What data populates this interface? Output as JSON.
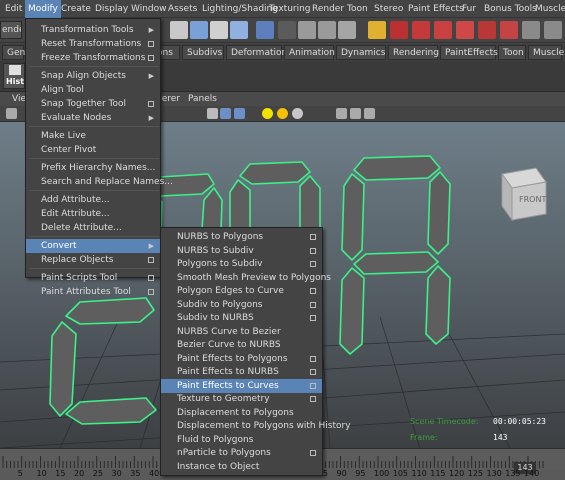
{
  "menubar": {
    "items": [
      {
        "label": "Edit"
      },
      {
        "label": "Modify"
      },
      {
        "label": "Create"
      },
      {
        "label": "Display"
      },
      {
        "label": "Window"
      },
      {
        "label": "Assets"
      },
      {
        "label": "Lighting/Shading"
      },
      {
        "label": "Texturing"
      },
      {
        "label": "Render"
      },
      {
        "label": "Toon"
      },
      {
        "label": "Stereo"
      },
      {
        "label": "Paint Effects"
      },
      {
        "label": "Fur"
      },
      {
        "label": "Bonus Tools"
      },
      {
        "label": "Muscle"
      }
    ],
    "active": "Modify"
  },
  "toolbar": {
    "mode_partial": "endering"
  },
  "shelf_tabs": [
    {
      "label": "Gen"
    },
    {
      "label": "ons"
    },
    {
      "label": "Subdivs"
    },
    {
      "label": "Deformation"
    },
    {
      "label": "Animation"
    },
    {
      "label": "Dynamics"
    },
    {
      "label": "Rendering"
    },
    {
      "label": "PaintEffects"
    },
    {
      "label": "Toon"
    },
    {
      "label": "Muscle"
    }
  ],
  "shelf": {
    "hist_label": "Hist"
  },
  "viewport": {
    "menu": [
      {
        "label": "Vie"
      },
      {
        "label": "derer"
      },
      {
        "label": "Panels"
      }
    ],
    "viewcube_label": "FRONT",
    "hud": {
      "time_label": "Scene Timecode:",
      "time_value": "00:00:05:23",
      "frame_label": "Frame:",
      "frame_value": "143"
    }
  },
  "modify_menu": {
    "items": [
      {
        "label": "Transformation Tools",
        "suffix": "arrow"
      },
      {
        "label": "Reset Transformations",
        "suffix": "box"
      },
      {
        "label": "Freeze Transformations",
        "suffix": "box"
      },
      {
        "label": "Snap Align Objects",
        "suffix": "arrow"
      },
      {
        "label": "Align Tool",
        "suffix": ""
      },
      {
        "label": "Snap Together Tool",
        "suffix": "box"
      },
      {
        "label": "Evaluate Nodes",
        "suffix": "arrow"
      },
      {
        "label": "Make Live",
        "suffix": ""
      },
      {
        "label": "Center Pivot",
        "suffix": ""
      },
      {
        "label": "Prefix Hierarchy Names...",
        "suffix": ""
      },
      {
        "label": "Search and Replace Names...",
        "suffix": ""
      },
      {
        "label": "Add Attribute...",
        "suffix": ""
      },
      {
        "label": "Edit Attribute...",
        "suffix": ""
      },
      {
        "label": "Delete Attribute...",
        "suffix": ""
      },
      {
        "label": "Convert",
        "suffix": "arrow"
      },
      {
        "label": "Replace Objects",
        "suffix": "box"
      },
      {
        "label": "Paint Scripts Tool",
        "suffix": "box"
      },
      {
        "label": "Paint Attributes Tool",
        "suffix": "box"
      }
    ],
    "active": "Convert"
  },
  "convert_menu": {
    "items": [
      {
        "label": "NURBS to Polygons",
        "suffix": "box"
      },
      {
        "label": "NURBS to Subdiv",
        "suffix": "box"
      },
      {
        "label": "Polygons to Subdiv",
        "suffix": "box"
      },
      {
        "label": "Smooth Mesh Preview to Polygons",
        "suffix": ""
      },
      {
        "label": "Polygon Edges to Curve",
        "suffix": "box"
      },
      {
        "label": "Subdiv to Polygons",
        "suffix": "box"
      },
      {
        "label": "Subdiv to NURBS",
        "suffix": "box"
      },
      {
        "label": "NURBS Curve to Bezier",
        "suffix": ""
      },
      {
        "label": "Bezier Curve to NURBS",
        "suffix": ""
      },
      {
        "label": "Paint Effects to Polygons",
        "suffix": "box"
      },
      {
        "label": "Paint Effects to NURBS",
        "suffix": "box"
      },
      {
        "label": "Paint Effects to Curves",
        "suffix": "box"
      },
      {
        "label": "Texture to Geometry",
        "suffix": "box"
      },
      {
        "label": "Displacement to Polygons",
        "suffix": ""
      },
      {
        "label": "Displacement to Polygons with History",
        "suffix": ""
      },
      {
        "label": "Fluid to Polygons",
        "suffix": ""
      },
      {
        "label": "nParticle to Polygons",
        "suffix": "box"
      },
      {
        "label": "Instance to Object",
        "suffix": ""
      }
    ],
    "active": "Paint Effects to Curves"
  },
  "timeline": {
    "numbers": [
      "5",
      "10",
      "15",
      "20",
      "25",
      "30",
      "35",
      "40",
      "45",
      "50",
      "55",
      "60",
      "65",
      "70",
      "75",
      "80",
      "85",
      "90",
      "95",
      "100",
      "105",
      "110",
      "115",
      "120",
      "125",
      "130",
      "135",
      "140"
    ],
    "current": "143"
  },
  "colors": {
    "accent": "#5b84b6",
    "ui_bg": "#444444",
    "viewport_bg": "#6f7f88",
    "segment_fill": "#5e5e5e",
    "segment_outline": "#3cf08a",
    "hud_label": "#3b9a3b"
  }
}
